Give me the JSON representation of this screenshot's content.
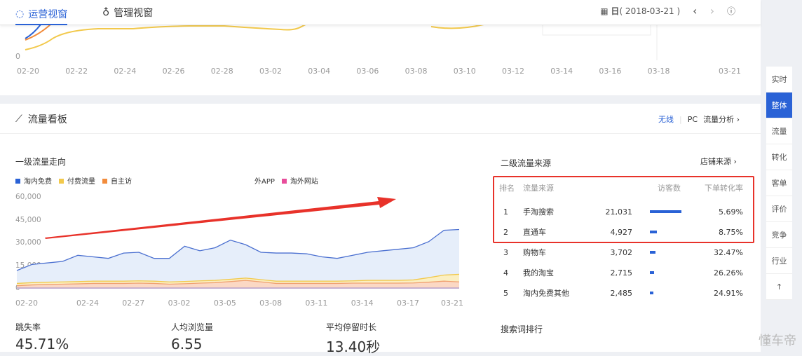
{
  "tabs": [
    {
      "label": "运营视窗",
      "icon": "shield-icon"
    },
    {
      "label": "管理视窗",
      "icon": "medal-icon"
    }
  ],
  "date": {
    "period": "日",
    "value": "( 2018-03-21 )"
  },
  "top_chart": {
    "y_zero": "0",
    "x_ticks": [
      "02-20",
      "02-22",
      "02-24",
      "02-26",
      "02-28",
      "03-02",
      "03-04",
      "03-06",
      "03-08",
      "03-10",
      "03-12",
      "03-14",
      "03-16",
      "03-18",
      "03-21"
    ]
  },
  "panel": {
    "title": "流量看板",
    "links": [
      "无线",
      "PC",
      "流量分析"
    ]
  },
  "first_level": {
    "title": "一级流量走向",
    "legend": [
      {
        "name": "淘内免费",
        "color": "#2a62d6"
      },
      {
        "name": "付费流量",
        "color": "#f2c94c"
      },
      {
        "name": "自主访",
        "color": "#f28c3c"
      },
      {
        "name": "外APP",
        "color": ""
      },
      {
        "name": "淘外网站",
        "color": "#e84d9b"
      }
    ]
  },
  "chart_data": {
    "type": "area",
    "title": "一级流量走向",
    "stacked": true,
    "x": [
      "02-20",
      "02-21",
      "02-22",
      "02-23",
      "02-24",
      "02-25",
      "02-26",
      "02-27",
      "02-28",
      "03-01",
      "03-02",
      "03-03",
      "03-04",
      "03-05",
      "03-06",
      "03-07",
      "03-08",
      "03-09",
      "03-10",
      "03-11",
      "03-12",
      "03-13",
      "03-14",
      "03-15",
      "03-16",
      "03-17",
      "03-18",
      "03-19",
      "03-20",
      "03-21"
    ],
    "x_ticks": [
      "02-20",
      "02-24",
      "02-27",
      "03-02",
      "03-05",
      "03-08",
      "03-11",
      "03-14",
      "03-17",
      "03-21"
    ],
    "y_ticks": [
      "0",
      "15,000",
      "30,000",
      "45,000",
      "60,000"
    ],
    "ylim": [
      0,
      60000
    ],
    "series": [
      {
        "name": "淘外网站",
        "values": [
          500,
          500,
          500,
          500,
          500,
          500,
          500,
          500,
          500,
          500,
          500,
          500,
          500,
          500,
          500,
          500,
          500,
          500,
          500,
          500,
          500,
          500,
          500,
          500,
          500,
          500,
          500,
          500,
          500,
          500
        ]
      },
      {
        "name": "自主访",
        "values": [
          1500,
          2000,
          2300,
          2500,
          2700,
          3000,
          3000,
          3000,
          3200,
          3000,
          2500,
          2800,
          3200,
          3500,
          4200,
          5000,
          4000,
          3000,
          3000,
          3000,
          3000,
          3000,
          3200,
          3200,
          3200,
          3200,
          3300,
          3800,
          4500,
          4000
        ]
      },
      {
        "name": "付费流量",
        "values": [
          1500,
          1500,
          1500,
          1500,
          1500,
          1500,
          1500,
          1500,
          1500,
          1500,
          1500,
          1500,
          1500,
          1500,
          1500,
          1500,
          1500,
          1500,
          1500,
          1500,
          1500,
          1500,
          1500,
          1800,
          1800,
          1800,
          2000,
          3000,
          4000,
          5000
        ]
      },
      {
        "name": "淘内免费",
        "values": [
          8500,
          12000,
          12700,
          13500,
          17300,
          16000,
          15000,
          18500,
          18800,
          15000,
          15500,
          23200,
          19800,
          21500,
          25800,
          22000,
          18000,
          18500,
          18500,
          18000,
          16000,
          15000,
          16800,
          18500,
          19500,
          20500,
          21200,
          23700,
          29500,
          29500
        ]
      }
    ]
  },
  "second_level": {
    "title": "二级流量来源",
    "link": "店铺来源",
    "headers": [
      "排名",
      "流量来源",
      "访客数",
      "下单转化率"
    ],
    "rows": [
      {
        "rank": "1",
        "name": "手淘搜索",
        "visitors": "21,031",
        "share": 1.0,
        "rate": "5.69%"
      },
      {
        "rank": "2",
        "name": "直通车",
        "visitors": "4,927",
        "share": 0.23,
        "rate": "8.75%"
      },
      {
        "rank": "3",
        "name": "购物车",
        "visitors": "3,702",
        "share": 0.18,
        "rate": "32.47%"
      },
      {
        "rank": "4",
        "name": "我的淘宝",
        "visitors": "2,715",
        "share": 0.13,
        "rate": "26.26%"
      },
      {
        "rank": "5",
        "name": "淘内免费其他",
        "visitors": "2,485",
        "share": 0.12,
        "rate": "24.91%"
      }
    ]
  },
  "stats": [
    {
      "label": "跳失率",
      "value": "45.71%"
    },
    {
      "label": "人均浏览量",
      "value": "6.55"
    },
    {
      "label": "平均停留时长",
      "value": "13.40秒"
    }
  ],
  "search_rank": {
    "title": "搜索词排行"
  },
  "side_nav": [
    "实时",
    "整体",
    "流量",
    "转化",
    "客单",
    "评价",
    "竞争",
    "行业",
    "↑"
  ],
  "watermark": "懂车帝"
}
